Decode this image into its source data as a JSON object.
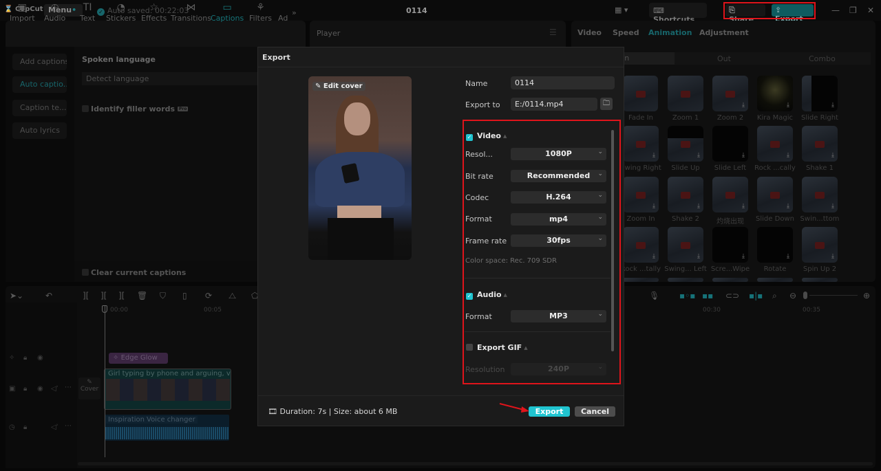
{
  "app": {
    "logo": "CopCut",
    "menu_label": "Menu",
    "autosave_text": "Auto saved: 00:22:03",
    "project_title": "0114",
    "shortcuts_label": "Shortcuts",
    "share_label": "Share",
    "export_label": "Export"
  },
  "media_toolbar": {
    "items": [
      {
        "label": "Import",
        "icon": "import-icon"
      },
      {
        "label": "Audio",
        "icon": "audio-icon"
      },
      {
        "label": "Text",
        "icon": "text-icon"
      },
      {
        "label": "Stickers",
        "icon": "stickers-icon"
      },
      {
        "label": "Effects",
        "icon": "effects-icon"
      },
      {
        "label": "Transitions",
        "icon": "transitions-icon"
      },
      {
        "label": "Captions",
        "icon": "captions-icon",
        "active": true
      },
      {
        "label": "Filters",
        "icon": "filters-icon"
      },
      {
        "label": "Ad",
        "icon": "adjust-icon"
      }
    ],
    "more_icon": "»"
  },
  "captions": {
    "side_items": [
      "Add captions",
      "Auto captio...",
      "Caption te...",
      "Auto lyrics"
    ],
    "active_item": "Auto captio...",
    "spoken_language_label": "Spoken language",
    "language_value": "Detect language",
    "filler_words_label": "Identify filler words",
    "pro_badge": "Pro",
    "clear_captions_label": "Clear current captions"
  },
  "player": {
    "title": "Player"
  },
  "right_panel": {
    "tabs": [
      "Video",
      "Speed",
      "Animation",
      "Adjustment"
    ],
    "active_tab": "Animation",
    "subtabs": [
      "In",
      "Out",
      "Combo"
    ],
    "animations": [
      [
        "Fade In",
        "Zoom 1",
        "Zoom 2",
        "Kira Magic",
        "Slide Right"
      ],
      [
        "Swing Right",
        "Slide Up",
        "Slide Left",
        "Rock ...cally",
        "Shake 1"
      ],
      [
        "Zoom In",
        "Shake 2",
        "灼烧出现",
        "Slide Down",
        "Swin...ttom"
      ],
      [
        "Rock ...tally",
        "Swing... Left",
        "Scre...Wipe",
        "Rotate",
        "Spin Up 2"
      ]
    ]
  },
  "timeline": {
    "ruler": [
      "00:00",
      "00:05",
      "00:30",
      "00:35"
    ],
    "effect_clip": "Edge Glow",
    "cover_label": "Cover",
    "video_clip_label": "Girl typing by phone and arguing, vertic",
    "audio_tags": [
      "Inspiration",
      "Voice changer"
    ]
  },
  "export_dialog": {
    "title": "Export",
    "edit_cover_label": "Edit cover",
    "name_label": "Name",
    "name_value": "0114",
    "export_to_label": "Export to",
    "export_to_value": "E:/0114.mp4",
    "video": {
      "header": "Video",
      "checked": true,
      "fields": [
        {
          "label": "Resol...",
          "value": "1080P"
        },
        {
          "label": "Bit rate",
          "value": "Recommended"
        },
        {
          "label": "Codec",
          "value": "H.264"
        },
        {
          "label": "Format",
          "value": "mp4"
        },
        {
          "label": "Frame rate",
          "value": "30fps"
        }
      ],
      "color_space": "Color space: Rec. 709 SDR"
    },
    "audio": {
      "header": "Audio",
      "checked": true,
      "format_label": "Format",
      "format_value": "MP3"
    },
    "gif": {
      "header": "Export GIF",
      "checked": false,
      "resolution_label": "Resolution",
      "resolution_value": "240P"
    },
    "footer_info": "Duration: 7s | Size: about 6 MB",
    "export_button": "Export",
    "cancel_button": "Cancel"
  },
  "colors": {
    "accent": "#20c4d0",
    "highlight_box": "#e0141b"
  }
}
